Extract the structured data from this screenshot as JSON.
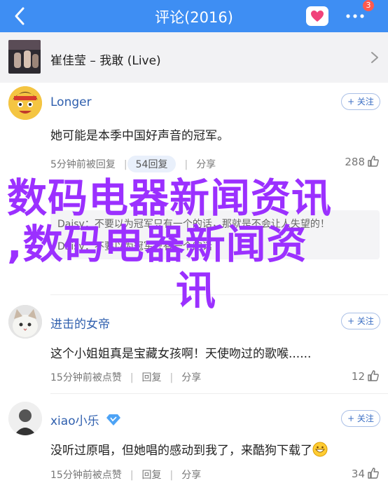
{
  "header": {
    "title": "评论(2016)",
    "badge_count": "3",
    "accent": "#3e8ef3"
  },
  "song": {
    "title": "崔佳莹 – 我敢 (Live)"
  },
  "comments": [
    {
      "user": "Longer",
      "follow_label": "+ 关注",
      "text": "她可能是本季中国好声音的冠军。",
      "meta": "5分钟前被回复",
      "reply_label": "54回复",
      "share_label": "分享",
      "likes": "288"
    },
    {
      "sub_line1": "Daisy：不要以为冠军只有一个的话，那就是不会让人失望的！",
      "sub_line2": "Daisy：不要以为冠军只有一个的话"
    },
    {
      "user": "进击的女帝",
      "follow_label": "+ 关注",
      "text": "这个小姐姐真是宝藏女孩啊！天使吻过的歌喉......",
      "meta": "15分钟前被点赞",
      "reply_label": "回复",
      "share_label": "分享",
      "likes": "12"
    },
    {
      "user": "xiao小乐",
      "follow_label": "+ 关注",
      "text": "没听过原唱，但她唱的感动到我了，来酷狗下载了",
      "meta": "15分钟前被点赞",
      "reply_label": "回复",
      "share_label": "分享",
      "likes": "34"
    }
  ],
  "watermark": {
    "line1": "数码电器新闻资讯",
    "line2": ",数码电器新闻资",
    "line3": "讯"
  }
}
